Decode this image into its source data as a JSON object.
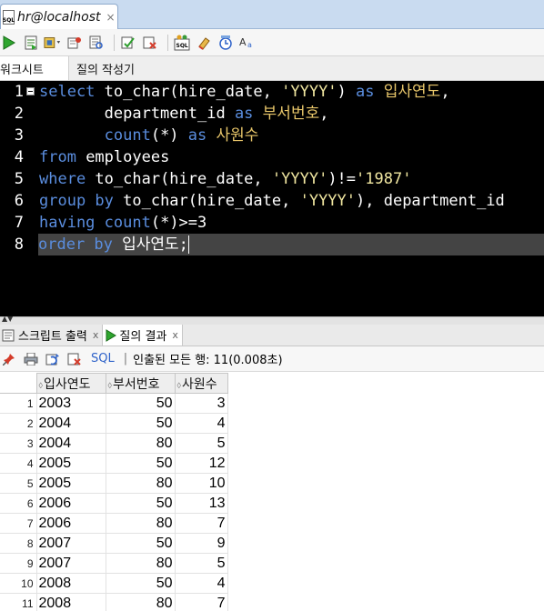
{
  "window": {
    "tab_title": "hr@localhost",
    "tab_close": "×",
    "tab_icon_text": "SQL"
  },
  "toolbar": {
    "buttons": [
      "run-statement",
      "run-script",
      "commit",
      "rollback",
      "explain-plan",
      "autotrace",
      "sql-tuning",
      "clear",
      "history",
      "format",
      "uppercase"
    ]
  },
  "subtabs": {
    "worksheet": "워크시트",
    "query_builder": "질의 작성기"
  },
  "editor": {
    "line_numbers": [
      "1",
      "2",
      "3",
      "4",
      "5",
      "6",
      "7",
      "8"
    ],
    "lines": [
      [
        {
          "t": "select",
          "c": "kw"
        },
        {
          "t": " to_char(hire_date, ",
          "c": "txt"
        },
        {
          "t": "'YYYY'",
          "c": "str"
        },
        {
          "t": ") ",
          "c": "txt"
        },
        {
          "t": "as",
          "c": "kw"
        },
        {
          "t": " ",
          "c": "txt"
        },
        {
          "t": "입사연도",
          "c": "kor"
        },
        {
          "t": ",",
          "c": "txt"
        }
      ],
      [
        {
          "t": "       department_id ",
          "c": "txt"
        },
        {
          "t": "as",
          "c": "kw"
        },
        {
          "t": " ",
          "c": "txt"
        },
        {
          "t": "부서번호",
          "c": "kor"
        },
        {
          "t": ",",
          "c": "txt"
        }
      ],
      [
        {
          "t": "       count",
          "c": "kw"
        },
        {
          "t": "(*) ",
          "c": "txt"
        },
        {
          "t": "as",
          "c": "kw"
        },
        {
          "t": " ",
          "c": "txt"
        },
        {
          "t": "사원수",
          "c": "kor"
        }
      ],
      [
        {
          "t": "from",
          "c": "kw"
        },
        {
          "t": " employees",
          "c": "txt"
        }
      ],
      [
        {
          "t": "where",
          "c": "kw"
        },
        {
          "t": " to_char(hire_date, ",
          "c": "txt"
        },
        {
          "t": "'YYYY'",
          "c": "str"
        },
        {
          "t": ")!=",
          "c": "txt"
        },
        {
          "t": "'1987'",
          "c": "str"
        }
      ],
      [
        {
          "t": "group by",
          "c": "kw"
        },
        {
          "t": " to_char(hire_date, ",
          "c": "txt"
        },
        {
          "t": "'YYYY'",
          "c": "str"
        },
        {
          "t": "), department_id",
          "c": "txt"
        }
      ],
      [
        {
          "t": "having",
          "c": "kw"
        },
        {
          "t": " count",
          "c": "kw"
        },
        {
          "t": "(*)>=3",
          "c": "txt"
        }
      ],
      [
        {
          "t": "order by",
          "c": "kw"
        },
        {
          "t": " 입사연도;",
          "c": "txt"
        }
      ]
    ],
    "current_line": 8,
    "colors": {
      "keyword": "#5a8dde",
      "string": "#f0e6a0",
      "korean": "#e8c66a",
      "text": "#ffffff",
      "background": "#000000",
      "current_line_bg": "#444444"
    }
  },
  "result_tabs": {
    "script_output": "스크립트 출력",
    "query_result": "질의 결과",
    "close": "x"
  },
  "result_toolbar": {
    "sql_label": "SQL",
    "separator": "|",
    "status": "인출된 모든 행: 11(0.008초)"
  },
  "grid": {
    "columns": [
      "입사연도",
      "부서번호",
      "사원수"
    ],
    "sort_glyph": "◊",
    "rows": [
      {
        "n": "1",
        "year": "2003",
        "dept": "50",
        "cnt": "3"
      },
      {
        "n": "2",
        "year": "2004",
        "dept": "50",
        "cnt": "4"
      },
      {
        "n": "3",
        "year": "2004",
        "dept": "80",
        "cnt": "5"
      },
      {
        "n": "4",
        "year": "2005",
        "dept": "50",
        "cnt": "12"
      },
      {
        "n": "5",
        "year": "2005",
        "dept": "80",
        "cnt": "10"
      },
      {
        "n": "6",
        "year": "2006",
        "dept": "50",
        "cnt": "13"
      },
      {
        "n": "7",
        "year": "2006",
        "dept": "80",
        "cnt": "7"
      },
      {
        "n": "8",
        "year": "2007",
        "dept": "50",
        "cnt": "9"
      },
      {
        "n": "9",
        "year": "2007",
        "dept": "80",
        "cnt": "5"
      },
      {
        "n": "10",
        "year": "2008",
        "dept": "50",
        "cnt": "4"
      },
      {
        "n": "11",
        "year": "2008",
        "dept": "80",
        "cnt": "7"
      }
    ]
  }
}
